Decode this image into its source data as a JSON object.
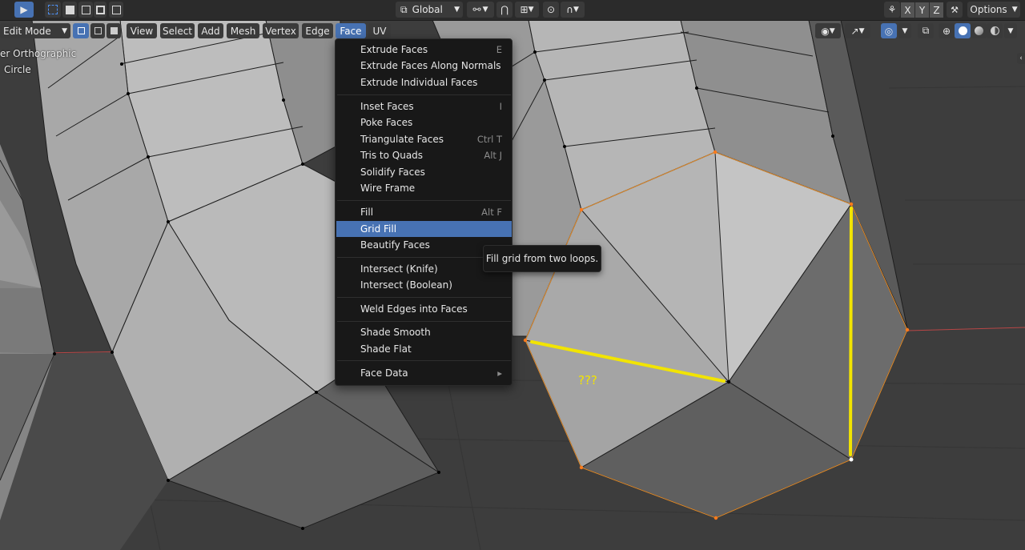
{
  "topbar": {
    "transform_orientation": "Global",
    "options_label": "Options",
    "axis_x": "X",
    "axis_y": "Y",
    "axis_z": "Z"
  },
  "header": {
    "mode": "Edit Mode",
    "menus": [
      "View",
      "Select",
      "Add",
      "Mesh",
      "Vertex",
      "Edge",
      "Face",
      "UV"
    ],
    "open_menu": "Face"
  },
  "viewport": {
    "view_name": "er Orthographic",
    "object_name": "Circle",
    "annotation": "???",
    "colors": {
      "annotation_yellow": "#f2e400",
      "selection_orange": "#e8902c",
      "axis_red": "#c64040"
    }
  },
  "face_menu": {
    "items": [
      {
        "label": "Extrude Faces",
        "shortcut": "E"
      },
      {
        "label": "Extrude Faces Along Normals",
        "shortcut": ""
      },
      {
        "label": "Extrude Individual Faces",
        "shortcut": ""
      },
      {
        "label": "Inset Faces",
        "shortcut": "I"
      },
      {
        "label": "Poke Faces",
        "shortcut": ""
      },
      {
        "label": "Triangulate Faces",
        "shortcut": "Ctrl T"
      },
      {
        "label": "Tris to Quads",
        "shortcut": "Alt J"
      },
      {
        "label": "Solidify Faces",
        "shortcut": ""
      },
      {
        "label": "Wire Frame",
        "shortcut": ""
      },
      {
        "label": "Fill",
        "shortcut": "Alt F"
      },
      {
        "label": "Grid Fill",
        "shortcut": ""
      },
      {
        "label": "Beautify Faces",
        "shortcut": ""
      },
      {
        "label": "Intersect (Knife)",
        "shortcut": ""
      },
      {
        "label": "Intersect (Boolean)",
        "shortcut": ""
      },
      {
        "label": "Weld Edges into Faces",
        "shortcut": ""
      },
      {
        "label": "Shade Smooth",
        "shortcut": ""
      },
      {
        "label": "Shade Flat",
        "shortcut": ""
      },
      {
        "label": "Face Data",
        "shortcut": ""
      }
    ],
    "highlighted": "Grid Fill",
    "submenu_arrow": "▸"
  },
  "tooltip": {
    "text": "Fill grid from two loops."
  }
}
